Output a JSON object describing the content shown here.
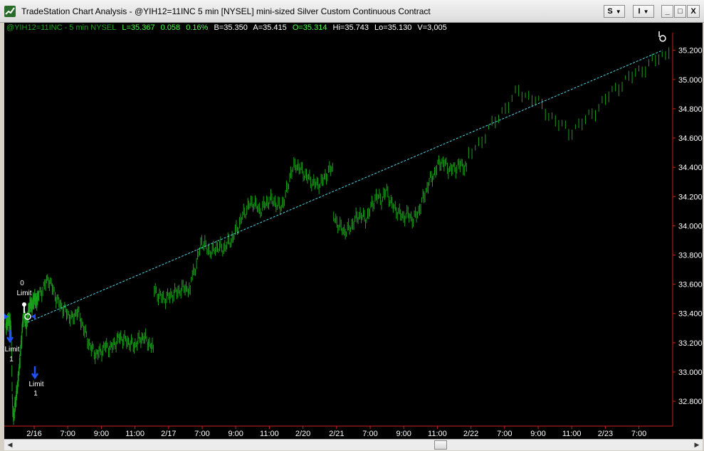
{
  "window": {
    "title": "TradeStation Chart Analysis - @YIH12=11INC 5 min [NYSEL] mini-sized Silver Custom Continuous Contract",
    "btn_s": "S",
    "btn_i": "I",
    "btn_min": "_",
    "btn_max": "□",
    "btn_close": "X"
  },
  "status": {
    "symbol": "@YIH12=11INC - 5 min  NYSEL",
    "last": "L=35.367",
    "change": "0.058",
    "pct": "0.16%",
    "bid": "B=35.350",
    "ask": "A=35.415",
    "open": "O=35.314",
    "high": "Hi=35.743",
    "low": "Lo=35.130",
    "volume": "V=3,005"
  },
  "annotations": {
    "buy_qty": "0",
    "buy_type": "Limit",
    "sell1_type": "Limit",
    "sell1_qty": "1",
    "sell2_type": "Limit",
    "sell2_qty": "1"
  },
  "chart_data": {
    "type": "bar",
    "ylim": [
      32.64,
      35.32
    ],
    "y_ticks": [
      "35.200",
      "35.000",
      "34.800",
      "34.600",
      "34.400",
      "34.200",
      "34.000",
      "33.800",
      "33.600",
      "33.400",
      "33.200",
      "33.000",
      "32.800"
    ],
    "x_ticks": [
      "2/16",
      "7:00",
      "9:00",
      "11:00",
      "2/17",
      "7:00",
      "9:00",
      "11:00",
      "2/20",
      "2/21",
      "7:00",
      "9:00",
      "11:00",
      "2/22",
      "7:00",
      "9:00",
      "11:00",
      "2/23",
      "7:00"
    ],
    "trendline": {
      "from": 33.34,
      "to": 35.2
    },
    "segments": [
      {
        "name": "2/16",
        "points": [
          33.3,
          33.33,
          33.35,
          33.36,
          33.34,
          33.28,
          32.82,
          32.68,
          32.74,
          32.8,
          32.86,
          32.92,
          33.0,
          33.08,
          33.18,
          33.28,
          33.38,
          33.42,
          33.36,
          33.32,
          33.38,
          33.42,
          33.46,
          33.48,
          33.44,
          33.48,
          33.5,
          33.52,
          33.48,
          33.5,
          33.52
        ]
      },
      {
        "name": "2/17",
        "points": [
          33.52,
          33.58,
          33.64,
          33.56,
          33.48,
          33.44,
          33.4,
          33.36,
          33.42,
          33.34,
          33.24,
          33.16,
          33.12,
          33.14,
          33.18,
          33.16,
          33.2,
          33.24,
          33.22,
          33.2,
          33.18,
          33.22,
          33.24,
          33.2,
          33.16
        ]
      },
      {
        "name": "2/20",
        "points": [
          33.56,
          33.52,
          33.5,
          33.52,
          33.54,
          33.56,
          33.58,
          33.56
        ]
      },
      {
        "name": "2/21",
        "points": [
          33.64,
          33.74,
          33.9,
          33.84,
          33.82,
          33.86,
          33.84,
          33.88,
          33.92,
          34.0,
          34.08,
          34.14,
          34.16,
          34.1,
          34.14,
          34.18,
          34.16,
          34.12,
          34.2,
          34.36,
          34.42,
          34.38,
          34.34,
          34.3,
          34.28,
          34.3,
          34.36,
          34.4
        ]
      },
      {
        "name": "2/22",
        "points": [
          34.06,
          34.0,
          33.96,
          33.98,
          34.04,
          34.08,
          34.04,
          34.12,
          34.2,
          34.18,
          34.24,
          34.14,
          34.1,
          34.06,
          34.08,
          34.04,
          34.1,
          34.2,
          34.3,
          34.36,
          34.44,
          34.42,
          34.38,
          34.4,
          34.42,
          34.4
        ]
      },
      {
        "name": "2/23",
        "points": [
          34.48,
          34.62,
          34.78,
          34.92,
          34.86,
          34.74,
          34.64,
          34.72,
          34.84,
          34.96,
          35.04,
          35.12,
          35.18
        ]
      }
    ]
  }
}
